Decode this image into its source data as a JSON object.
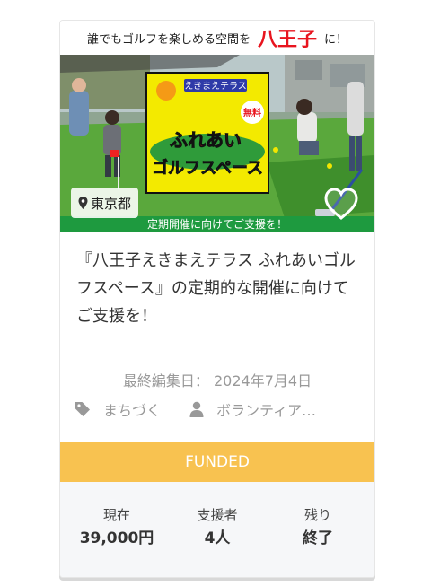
{
  "card": {
    "image": {
      "banner_lead": "誰でもゴルフを楽しめる空間を",
      "banner_place": "八王子",
      "banner_tail": "に！",
      "sign_top": "えきまえテラス",
      "sign_badge": "無料",
      "sign_line1": "ふれあい",
      "sign_line2": "ゴルフスペース",
      "bottom_strip": "定期開催に向けてご支援を！",
      "location": "東京都",
      "location_icon": "map-pin-icon",
      "favorite_icon": "heart-icon"
    },
    "title": "『八王子えきまえテラス ふれあいゴルフスペース』の定期的な開催に向けてご支援を！",
    "updated_label": "最終編集日：",
    "updated_date": "2024年7月4日",
    "tags": [
      {
        "icon": "tag-icon",
        "label": "まちづく"
      },
      {
        "icon": "user-icon",
        "label": "ボランティア…"
      }
    ],
    "status": "FUNDED",
    "stats": [
      {
        "label": "現在",
        "value": "39,000円"
      },
      {
        "label": "支援者",
        "value": "4人"
      },
      {
        "label": "残り",
        "value": "終了"
      }
    ]
  },
  "colors": {
    "status_bar": "#f8c250",
    "banner_place": "#e8141e",
    "bottom_strip": "#1e9a3f",
    "stats_bg": "#f6f7f9"
  }
}
